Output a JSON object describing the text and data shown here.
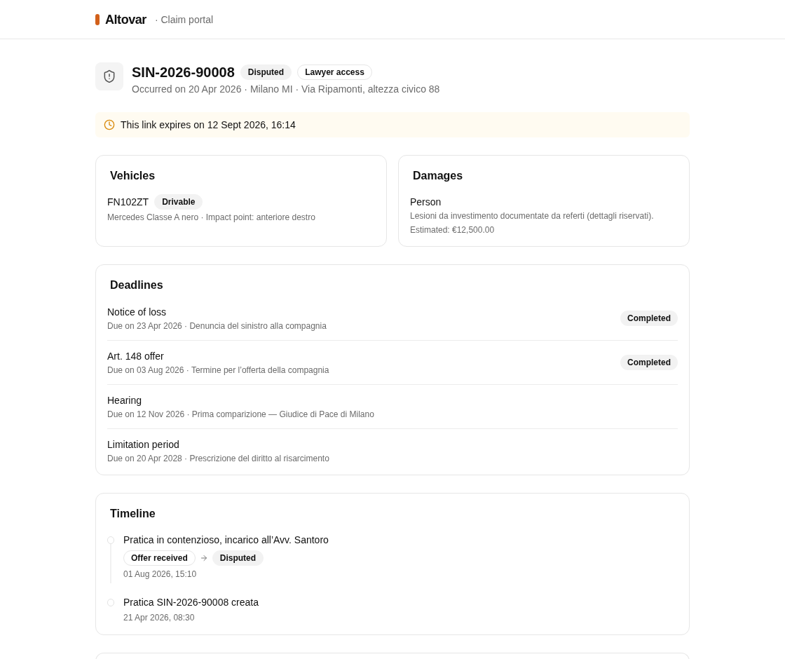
{
  "header": {
    "brand": "Altovar",
    "subtitle": "· Claim portal"
  },
  "claim": {
    "number": "SIN-2026-90008",
    "badges": [
      {
        "label": "Disputed",
        "kind": "filled"
      },
      {
        "label": "Lawyer access",
        "kind": "outline"
      }
    ],
    "details": "Occurred on 20 Apr 2026 · Milano MI · Via Ripamonti, altezza civico 88"
  },
  "notice": {
    "text": "This link expires on 12 Sept 2026, 16:14"
  },
  "vehicles": {
    "title": "Vehicles",
    "items": [
      {
        "plate": "FN102ZT",
        "badge": {
          "label": "Drivable",
          "kind": "filled"
        },
        "description": "Mercedes Classe A nero · Impact point: anteriore destro"
      }
    ]
  },
  "damages": {
    "title": "Damages",
    "items": [
      {
        "type": "Person",
        "description": "Lesioni da investimento documentate da referti (dettagli riservati).",
        "estimate": "Estimated: €12,500.00"
      }
    ]
  },
  "deadlines": {
    "title": "Deadlines",
    "items": [
      {
        "name": "Notice of loss",
        "details": "Due on 23 Apr 2026 · Denuncia del sinistro alla compagnia",
        "completed": true,
        "status": "Completed"
      },
      {
        "name": "Art. 148 offer",
        "details": "Due on 03 Aug 2026 · Termine per l’offerta della compagnia",
        "completed": true,
        "status": "Completed"
      },
      {
        "name": "Hearing",
        "details": "Due on 12 Nov 2026 · Prima comparizione — Giudice di Pace di Milano",
        "completed": false
      },
      {
        "name": "Limitation period",
        "details": "Due on 20 Apr 2028 · Prescrizione del diritto al risarcimento",
        "completed": false
      }
    ]
  },
  "timeline": {
    "title": "Timeline",
    "events": [
      {
        "text": "Pratica in contenzioso, incarico all’Avv. Santoro",
        "transition": {
          "from": {
            "label": "Offer received",
            "kind": "outline"
          },
          "to": {
            "label": "Disputed",
            "kind": "filled"
          }
        },
        "time": "01 Aug 2026, 15:10"
      },
      {
        "text": "Pratica SIN-2026-90008 creata",
        "time": "21 Apr 2026, 08:30"
      }
    ]
  }
}
